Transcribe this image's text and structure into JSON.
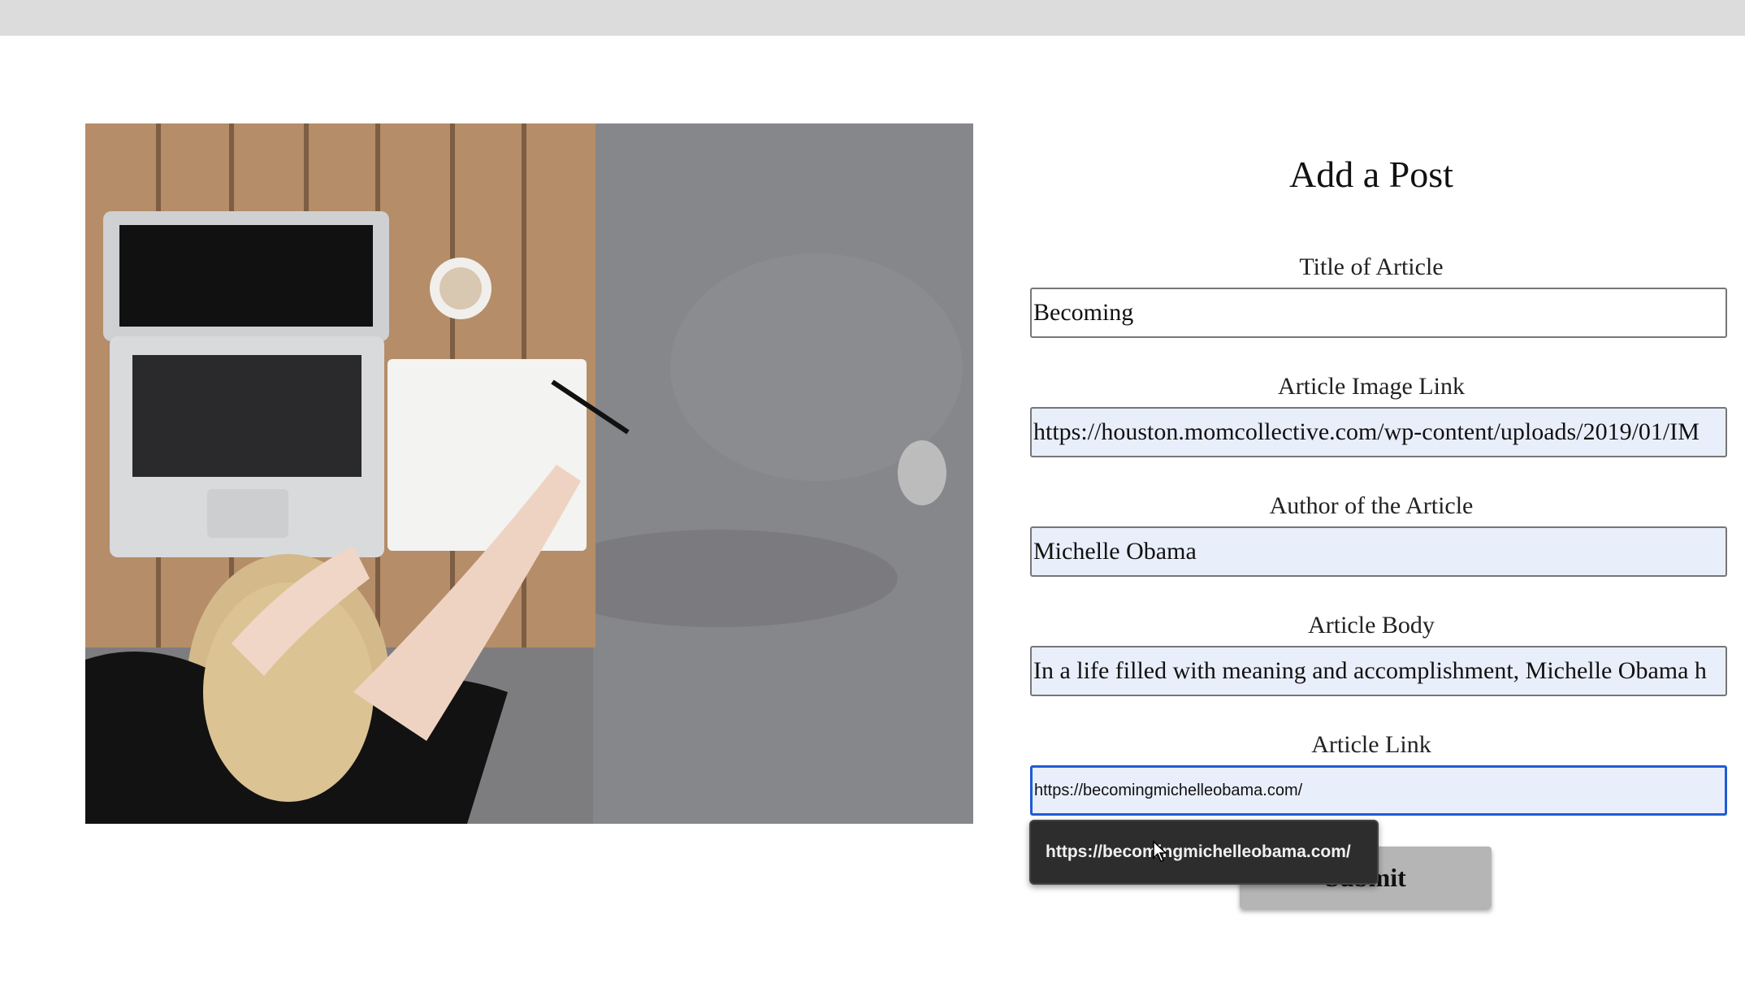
{
  "form": {
    "title": "Add a Post",
    "fields": [
      {
        "label": "Title of Article",
        "value": "Becoming"
      },
      {
        "label": "Article Image Link",
        "value": "https://houston.momcollective.com/wp-content/uploads/2019/01/IM"
      },
      {
        "label": "Author of the Article",
        "value": "Michelle Obama"
      },
      {
        "label": "Article Body",
        "value": "In a life filled with meaning and accomplishment, Michelle Obama h"
      },
      {
        "label": "Article Link",
        "value": "https://becomingmichelleobama.com/"
      }
    ],
    "submit_label": "Submit"
  },
  "autofill": {
    "suggestion": "https://becomingmichelleobama.com/"
  },
  "hero_image": {
    "description_icon": "photo-woman-laptop-notebook"
  },
  "colors": {
    "top_bar": "#dcdcdc",
    "input_autofill_bg": "#e9eefb",
    "focus_border": "#1f5bd6",
    "button_bg": "#b5b5b5",
    "tooltip_bg": "#2d2d2d"
  }
}
